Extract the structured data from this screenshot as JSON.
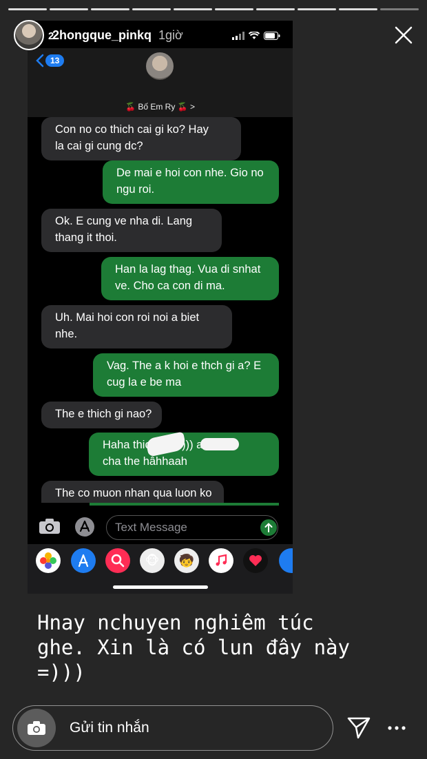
{
  "story": {
    "username_visible": "2hongque_pinkq",
    "time_ago": "1giờ",
    "segments_total": 10,
    "segments_seen": 9
  },
  "screenshot": {
    "status_clock": "2",
    "back_count": "13",
    "contact_name": "🍒 Bố Em Ry 🍒 >",
    "messages": [
      {
        "dir": "in",
        "text": "Con no co thich cai gi ko? Hay\nla cai gi cung dc?"
      },
      {
        "dir": "out",
        "text": "De mai e hoi con nhe. Gio no\nngu roi."
      },
      {
        "dir": "in",
        "text": "Ok. E cung ve nha di. Lang\nthang it thoi."
      },
      {
        "dir": "out",
        "text": "Han la lag thag. Vua di snhat\nve. Cho ca con di ma."
      },
      {
        "dir": "in",
        "text": "Uh. Mai hoi con roi noi a biet\nnhe."
      },
      {
        "dir": "out",
        "text": "Vag. The a k hoi e thch gi a? E\ncug la e be ma"
      },
      {
        "dir": "in",
        "text": "The e thich gi nao?"
      },
      {
        "dir": "out",
        "text": "Haha thich        và         =))) ai\ncha the hâhhaah"
      },
      {
        "dir": "in",
        "text": "The co muon nhan qua luon ko\nnao?"
      }
    ],
    "input_placeholder": "Text Message"
  },
  "caption": "Hnay nchuyen nghiêm túc\nghe. Xin là có lun đây này\n=)))",
  "reply": {
    "placeholder": "Gửi tin nhắn"
  },
  "colors": {
    "background": "#262626",
    "bubble_out": "#1d7c36",
    "bubble_in": "#2c2c2e",
    "ios_blue": "#1e7cf0"
  }
}
